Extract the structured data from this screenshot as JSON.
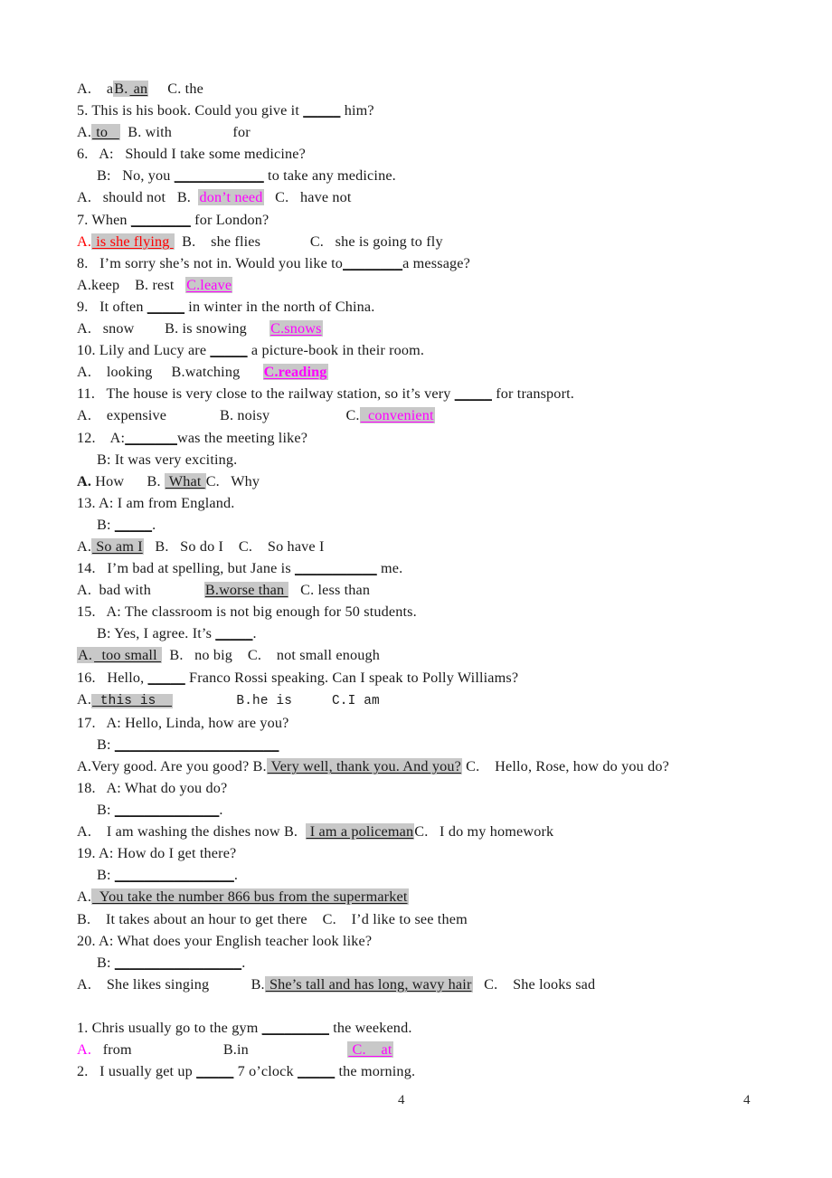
{
  "document": {
    "type": "english-grammar-worksheet-answer-key",
    "page_number": "4",
    "footer": {
      "page_center": "4",
      "page_right": "4"
    }
  },
  "lines": {
    "q4_options": {
      "a": "A.    a",
      "b_label": "B.",
      "b_answer": " an",
      "c": "     C. the"
    },
    "q5_stem": "5. This is his book. Could you give it ",
    "q5_blank": "_____",
    "q5_stem_end": " him?",
    "q5_options": {
      "a_label": "A.",
      "a_answer": " to   ",
      "b": "  B. with",
      "c": "                for"
    },
    "q6_a": "6.   A:   Should I take some medicine?",
    "q6_b_pre": "B:   No, you ",
    "q6_b_blank": "____________",
    "q6_b_post": " to take any medicine.",
    "q6_options": {
      "a": "A.   should not   B.  ",
      "b_answer": "don’t need",
      "c": "   C.   have not"
    },
    "q7_stem": "7. When ",
    "q7_blank": "________",
    "q7_stem_end": " for London?",
    "q7_options": {
      "a_label": "A.",
      "a_answer": " is she flying ",
      "b": "  B.    she flies",
      "c": "             C.   she is going to fly"
    },
    "q8_stem": "8.   I’m sorry she’s not in. Would you like to",
    "q8_blank": "________",
    "q8_stem_end": "a message?",
    "q8_options": {
      "ab": "A.keep    B. rest   ",
      "c_answer": "C.leave"
    },
    "q9_stem": "9.   It often ",
    "q9_blank": "_____",
    "q9_stem_end": " in winter in the north of China.",
    "q9_options": {
      "ab": "A.   snow        B. is snowing      ",
      "c_answer": "C.snows"
    },
    "q10_stem": "10. Lily and Lucy are ",
    "q10_blank": "_____",
    "q10_stem_end": " a picture-book in their room.",
    "q10_options": {
      "ab": "A.    looking     B.watching      ",
      "c_answer": "C.reading"
    },
    "q11_stem": "11.   The house is very close to the railway station, so it’s very ",
    "q11_blank": "_____",
    "q11_stem_end": " for transport.",
    "q11_options": {
      "ab": "A.    expensive              B. noisy                    C.",
      "c_answer": "  convenient"
    },
    "q12_a": "12.    A:",
    "q12_a_blank": "_______",
    "q12_a_end": "was the meeting like?",
    "q12_b": "B: It was very exciting.",
    "q12_options": {
      "a_label": "A.",
      "a_rest": " How      B. ",
      "b_answer": " What ",
      "c": "C.   Why"
    },
    "q13_a": "13. A: I am from England.",
    "q13_b": "B: ",
    "q13_b_blank": "_____",
    "q13_b_end": ".",
    "q13_options": {
      "a_label": "A.",
      "a_answer": " So am I",
      "bc": "   B.   So do I    C.    So have I"
    },
    "q14_stem": "14.   I’m bad at spelling, but Jane is ",
    "q14_blank": "___________",
    "q14_stem_end": " me.",
    "q14_options": {
      "a": "A.  bad with              ",
      "b_answer": "B.worse than ",
      "c": "   C. less than"
    },
    "q15_a": "15.   A: The classroom is not big enough for 50 students.",
    "q15_b": "B: Yes, I agree. It’s ",
    "q15_b_blank": "_____",
    "q15_b_end": ".",
    "q15_options": {
      "a_label": "A.",
      "a_answer": "  too small ",
      "bc": "  B.   no big    C.    not small enough"
    },
    "q16_stem": "16.   Hello, ",
    "q16_blank": "_____",
    "q16_stem_end": " Franco Rossi speaking. Can I speak to Polly Williams?",
    "q16_options": {
      "a_label": "A.",
      "a_answer": " this is  ",
      "bc": "        B.he is     C.I am"
    },
    "q17_a": "17.   A: Hello, Linda, how are you?",
    "q17_b": "B: ",
    "q17_b_blank": "______________________",
    "q17_options": {
      "a": "A.Very good. Are you good? B.",
      "b_answer": " Very well, thank you. And you?",
      "c": " C.    Hello, Rose, how do you do?"
    },
    "q18_a": "18.   A: What do you do?",
    "q18_b": "B: ",
    "q18_b_blank": "______________",
    "q18_b_end": ".",
    "q18_options": {
      "a": "A.    I am washing the dishes now B.  ",
      "b_answer": " I am a policeman",
      "c": "C.   I do my homework"
    },
    "q19_a": "19. A: How do I get there?",
    "q19_b": "B: ",
    "q19_b_blank": "________________",
    "q19_b_end": ".",
    "q19_option_a": {
      "label": "A.",
      "answer": "  You take the number 866 bus from the supermarket"
    },
    "q19_options_bc": "B.    It takes about an hour to get there    C.    I’d like to see them",
    "q20_a": "20. A: What does your English teacher look like?",
    "q20_b": "B: ",
    "q20_b_blank": "_________________",
    "q20_b_end": ".",
    "q20_options": {
      "a": "A.    She likes singing           B.",
      "b_answer": " She’s tall and has long, wavy hair",
      "c": "   C.    She looks sad"
    },
    "s2_q1_stem": "1. Chris usually go to the gym ",
    "s2_q1_blank": "_________",
    "s2_q1_stem_end": " the weekend.",
    "s2_q1_options": {
      "a_label": "A.",
      "a_rest": "   from                        B.in                          ",
      "c_answer": " C.    at"
    },
    "s2_q2_stem": "2.   I usually get up ",
    "s2_q2_blank": "_____",
    "s2_q2_mid": " 7 o’clock ",
    "s2_q2_blank2": "_____",
    "s2_q2_end": " the morning."
  },
  "colors": {
    "text": "#1a1a1a",
    "highlight": "#c8c8c8",
    "magenta": "#ff00ff",
    "red": "#ff0000",
    "page_background": "#ffffff"
  }
}
